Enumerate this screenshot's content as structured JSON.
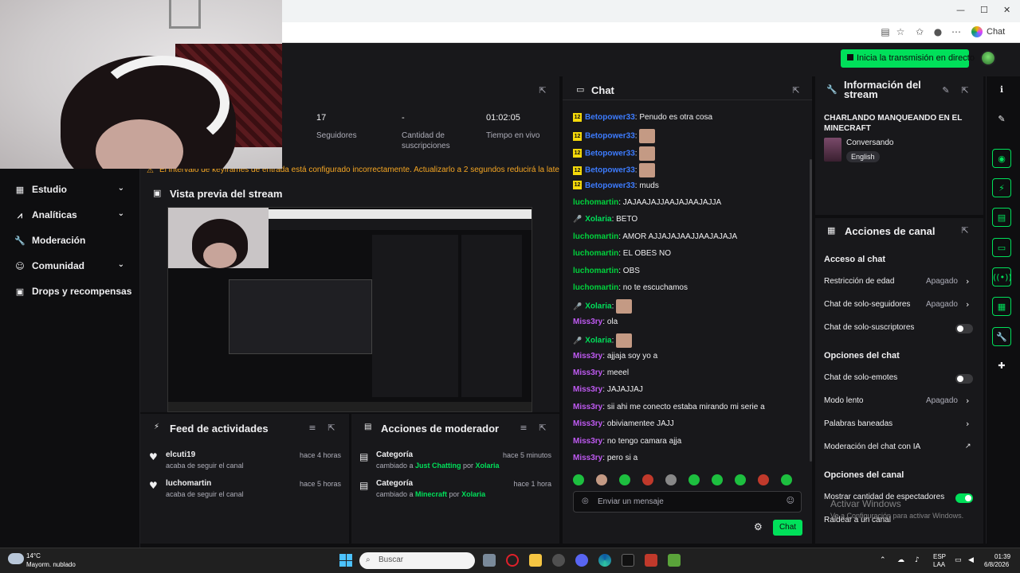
{
  "browser": {
    "chat_label": "Chat",
    "min": "—",
    "max": "☐",
    "close": "✕"
  },
  "topbar": {
    "go_live": "Inicia la transmisión en directo"
  },
  "nav": [
    {
      "label": "Estudio",
      "icon": "grid-icon",
      "chev": true
    },
    {
      "label": "Analíticas",
      "icon": "analytics-icon",
      "chev": true
    },
    {
      "label": "Moderación",
      "icon": "wrench-icon",
      "chev": false
    },
    {
      "label": "Comunidad",
      "icon": "people-icon",
      "chev": true
    },
    {
      "label": "Drops y recompensas",
      "icon": "gift-icon",
      "chev": false
    }
  ],
  "stats": {
    "followers_value": "17",
    "followers_label": "Seguidores",
    "subs_value": "-",
    "subs_label": "Cantidad de suscripciones",
    "time_value": "01:02:05",
    "time_label": "Tiempo en vivo"
  },
  "warning": "El intervalo de keyframes de entrada está configurado incorrectamente. Actualizarlo a 2 segundos reducirá la latencia para los espectadores.",
  "preview": {
    "title": "Vista previa del stream"
  },
  "feed": {
    "title": "Feed de actividades",
    "items": [
      {
        "name": "elcuti19",
        "sub": "acaba de seguir el canal",
        "time": "hace 4 horas"
      },
      {
        "name": "luchomartin",
        "sub": "acaba de seguir el canal",
        "time": "hace 5 horas"
      }
    ]
  },
  "modactions": {
    "title": "Acciones de moderador",
    "items": [
      {
        "name": "Categoría",
        "pre": "cambiado a ",
        "game": "Just Chatting",
        "mid": " por ",
        "by": "Xolaria",
        "time": "hace 5 minutos"
      },
      {
        "name": "Categoría",
        "pre": "cambiado a ",
        "game": "Minecraft",
        "mid": " por ",
        "by": "Xolaria",
        "time": "hace 1 hora"
      }
    ]
  },
  "chat": {
    "title": "Chat",
    "input_placeholder": "Enviar un mensaje",
    "send": "Chat",
    "messages": [
      {
        "badge": "12",
        "user": "Betopower33",
        "cls": "u-beto",
        "text": "Penudo es otra cosa",
        "emote": false
      },
      {
        "badge": "12",
        "user": "Betopower33",
        "cls": "u-beto",
        "text": "",
        "emote": true
      },
      {
        "badge": "12",
        "user": "Betopower33",
        "cls": "u-beto",
        "text": "",
        "emote": true
      },
      {
        "badge": "12",
        "user": "Betopower33",
        "cls": "u-beto",
        "text": "",
        "emote": true
      },
      {
        "badge": "12",
        "user": "Betopower33",
        "cls": "u-beto",
        "text": "muds",
        "emote": false
      },
      {
        "badge": "",
        "user": "luchomartin",
        "cls": "u-lucho",
        "text": "JAJAAJAJJAAJAJAAJAJJA",
        "emote": false
      },
      {
        "badge": "mic",
        "user": "Xolaria",
        "cls": "u-xola",
        "text": "BETO",
        "emote": false
      },
      {
        "badge": "",
        "user": "luchomartin",
        "cls": "u-lucho",
        "text": "AMOR AJJAJAJAAJJAAJAJAJA",
        "emote": false
      },
      {
        "badge": "",
        "user": "luchomartin",
        "cls": "u-lucho",
        "text": "EL OBES NO",
        "emote": false
      },
      {
        "badge": "",
        "user": "luchomartin",
        "cls": "u-lucho",
        "text": "OBS",
        "emote": false
      },
      {
        "badge": "",
        "user": "luchomartin",
        "cls": "u-lucho",
        "text": "no te escuchamos",
        "emote": false
      },
      {
        "badge": "mic",
        "user": "Xolaria",
        "cls": "u-xola",
        "text": "",
        "emote": true
      },
      {
        "badge": "",
        "user": "Miss3ry",
        "cls": "u-miss",
        "text": "ola",
        "emote": false
      },
      {
        "badge": "mic",
        "user": "Xolaria",
        "cls": "u-xola",
        "text": "",
        "emote": true
      },
      {
        "badge": "",
        "user": "Miss3ry",
        "cls": "u-miss",
        "text": "ajjaja soy yo a",
        "emote": false
      },
      {
        "badge": "",
        "user": "Miss3ry",
        "cls": "u-miss",
        "text": "meeel",
        "emote": false
      },
      {
        "badge": "",
        "user": "Miss3ry",
        "cls": "u-miss",
        "text": "JAJAJJAJ",
        "emote": false
      },
      {
        "badge": "",
        "user": "Miss3ry",
        "cls": "u-miss",
        "text": "sii ahi me conecto estaba mirando mi serie a",
        "emote": false
      },
      {
        "badge": "",
        "user": "Miss3ry",
        "cls": "u-miss",
        "text": "obiviamentee JAJJ",
        "emote": false
      },
      {
        "badge": "",
        "user": "Miss3ry",
        "cls": "u-miss",
        "text": "no tengo camara ajja",
        "emote": false
      },
      {
        "badge": "",
        "user": "Miss3ry",
        "cls": "u-miss",
        "text": "pero si a",
        "emote": false
      }
    ]
  },
  "info": {
    "title": "Información del stream",
    "stream_title": "CHARLANDO MANQUEANDO EN EL MINECRAFT",
    "category": "Conversando",
    "tag": "English"
  },
  "actions": {
    "title": "Acciones de canal",
    "sec_access": "Acceso al chat",
    "rows_access": [
      {
        "label": "Restricción de edad",
        "value": "Apagado",
        "kind": "chev"
      },
      {
        "label": "Chat de solo-seguidores",
        "value": "Apagado",
        "kind": "chev"
      },
      {
        "label": "Chat de solo-suscriptores",
        "value": "",
        "kind": "toggle"
      }
    ],
    "sec_chat": "Opciones del chat",
    "rows_chat": [
      {
        "label": "Chat de solo-emotes",
        "value": "",
        "kind": "toggle"
      },
      {
        "label": "Modo lento",
        "value": "Apagado",
        "kind": "chev"
      },
      {
        "label": "Palabras baneadas",
        "value": "",
        "kind": "chev"
      },
      {
        "label": "Moderación del chat con IA",
        "value": "",
        "kind": "ext"
      }
    ],
    "sec_channel": "Opciones del canal",
    "rows_channel": [
      {
        "label": "Mostrar cantidad de espectadores",
        "value": "",
        "kind": "toggle-on"
      },
      {
        "label": "Raidear a un canal",
        "value": "",
        "kind": "none"
      }
    ]
  },
  "watermark": {
    "line1": "Activar Windows",
    "line2": "Ve a Configuración para activar Windows."
  },
  "taskbar": {
    "temp": "14°C",
    "weather": "Mayorm. nublado",
    "search": "Buscar",
    "lang1": "ESP",
    "lang2": "LAA",
    "time": "01:39",
    "date": "6/8/2026"
  },
  "colors": {
    "accent": "#00e05a",
    "panel": "#18181b",
    "bg": "#0e0e10"
  }
}
